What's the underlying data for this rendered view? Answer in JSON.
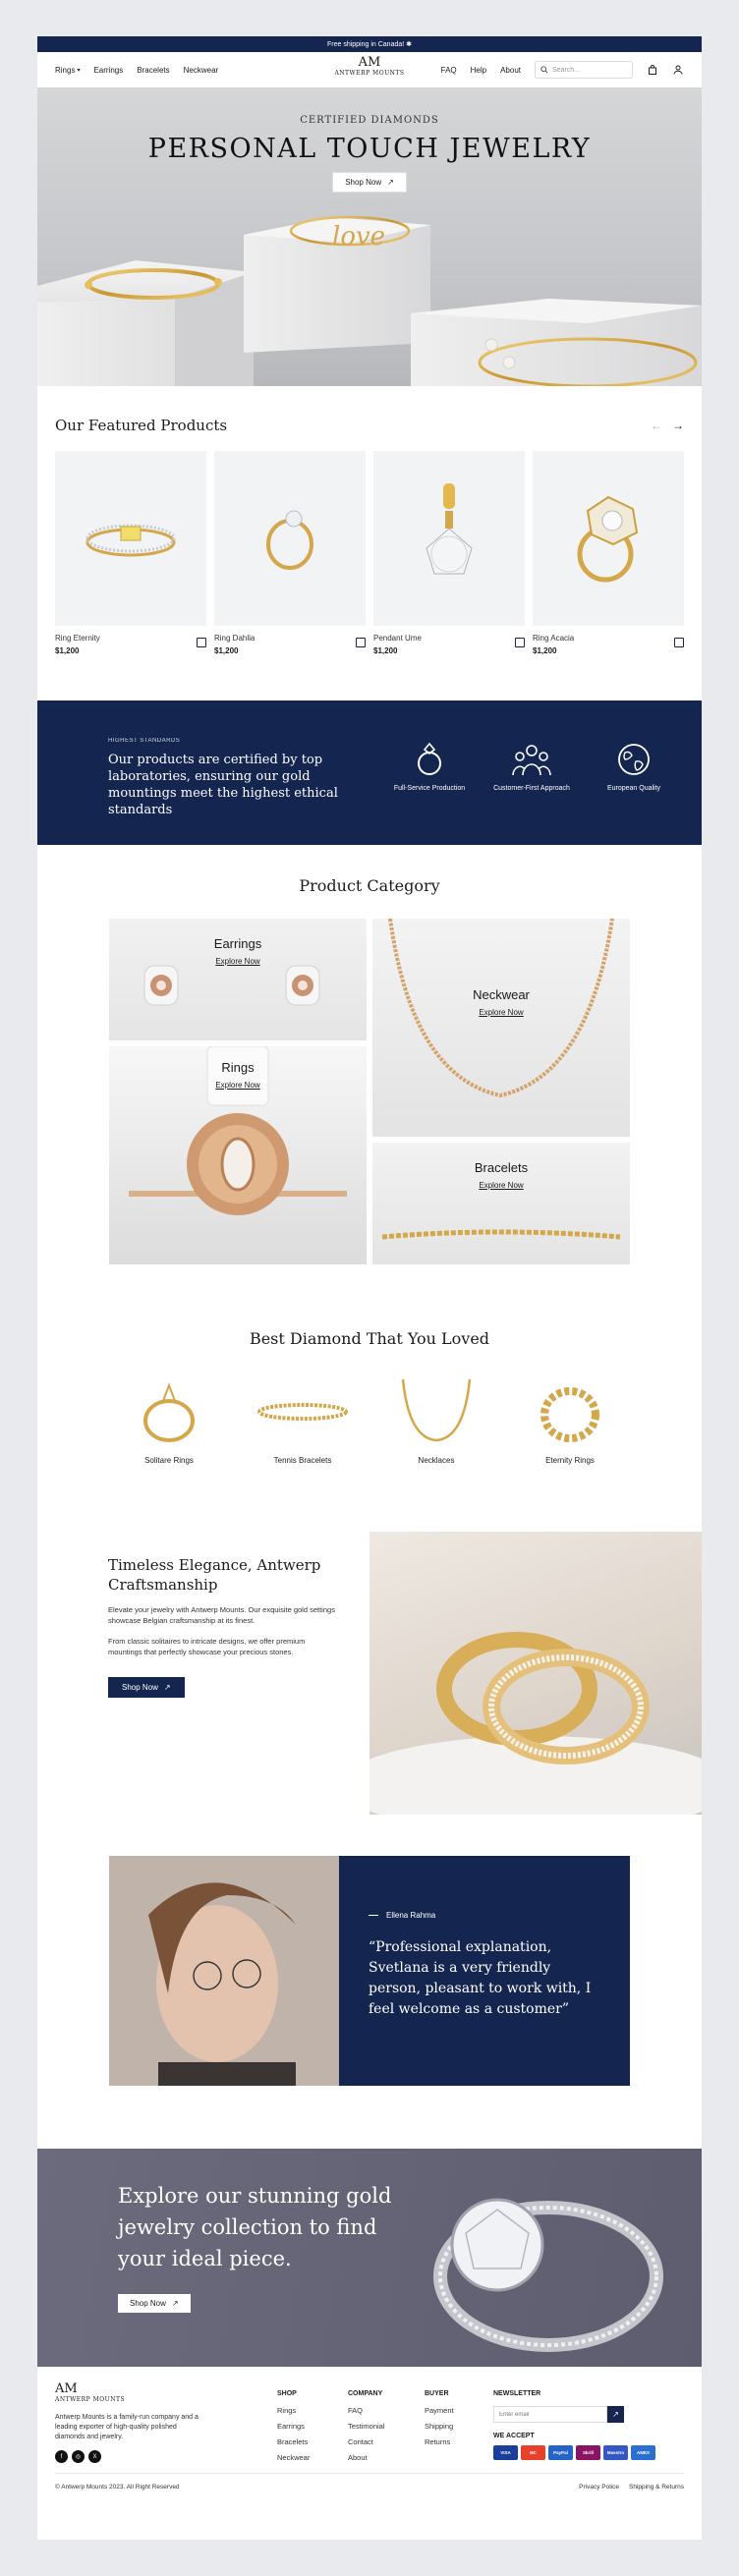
{
  "announcement": "Free shipping in Canada! ✱",
  "nav": {
    "left": [
      "Rings",
      "Earrings",
      "Bracelets",
      "Neckwear"
    ],
    "logo_mark": "AM",
    "logo_text": "ANTWERP MOUNTS",
    "right": [
      "FAQ",
      "Help",
      "About"
    ],
    "search_placeholder": "Search..."
  },
  "hero": {
    "eyebrow": "CERTIFIED DIAMONDS",
    "title": "PERSONAL TOUCH JEWELRY",
    "button": "Shop Now",
    "bracelet_script": "love"
  },
  "featured": {
    "title": "Our Featured Products",
    "products": [
      {
        "name": "Ring Eternity",
        "price": "$1,200"
      },
      {
        "name": "Ring Dahlia",
        "price": "$1,200"
      },
      {
        "name": "Pendant Ume",
        "price": "$1,200"
      },
      {
        "name": "Ring Acacia",
        "price": "$1,200"
      }
    ]
  },
  "standards": {
    "eyebrow": "HIGHEST STANDARDS",
    "text": "Our products are certified by top laboratories, ensuring our gold mountings meet the highest ethical standards",
    "items": [
      {
        "icon": "ring-icon",
        "label": "Full-Service Production"
      },
      {
        "icon": "people-icon",
        "label": "Customer-First Approach"
      },
      {
        "icon": "globe-icon",
        "label": "European Quality"
      }
    ]
  },
  "category": {
    "title": "Product Category",
    "tiles": [
      {
        "name": "Earrings",
        "link": "Explore Now"
      },
      {
        "name": "Neckwear",
        "link": "Explore Now"
      },
      {
        "name": "Rings",
        "link": "Explore Now"
      },
      {
        "name": "Bracelets",
        "link": "Explore Now"
      }
    ]
  },
  "loved": {
    "title": "Best Diamond That You Loved",
    "items": [
      "Solitare Rings",
      "Tennis Bracelets",
      "Necklaces",
      "Eternity Rings"
    ]
  },
  "timeless": {
    "title": "Timeless Elegance, Antwerp Craftsmanship",
    "p1": "Elevate your jewelry with Antwerp Mounts. Our exquisite gold settings showcase Belgian craftsmanship at its finest.",
    "p2": "From classic solitaires to intricate designs, we offer premium mountings that perfectly showcase your precious stones.",
    "button": "Shop Now"
  },
  "testimonial": {
    "name": "Ellena Rahma",
    "quote": "“Professional explanation, Svetlana is a very friendly person, pleasant to work with, I feel welcome as a customer”"
  },
  "explore": {
    "title": "Explore our stunning gold jewelry collection to find your ideal piece.",
    "button": "Shop Now"
  },
  "footer": {
    "description": "Antwerp Mounts is a family-run company and a leading exporter of high-quality polished diamonds and jewelry.",
    "socials": [
      "f",
      "◎",
      "X"
    ],
    "shop": {
      "title": "SHOP",
      "links": [
        "Rings",
        "Earrings",
        "Bracelets",
        "Neckwear"
      ]
    },
    "company": {
      "title": "COMPANY",
      "links": [
        "FAQ",
        "Testimonial",
        "Contact",
        "About"
      ]
    },
    "buyer": {
      "title": "BUYER",
      "links": [
        "Payment",
        "Shipping",
        "Returns"
      ]
    },
    "newsletter": {
      "title": "NEWSLETTER",
      "placeholder": "Enter email",
      "accept": "WE ACCEPT"
    },
    "payments": [
      {
        "label": "VISA",
        "color": "#1a3e9c"
      },
      {
        "label": "MC",
        "color": "#e8402a"
      },
      {
        "label": "PayPal",
        "color": "#2563c9"
      },
      {
        "label": "Skrill",
        "color": "#8a1464"
      },
      {
        "label": "Maestro",
        "color": "#3557c6"
      },
      {
        "label": "AMEX",
        "color": "#2b6fd0"
      }
    ],
    "copyright": "© Antwerp Mounts 2023. All Right Reserved",
    "bottom_links": [
      "Privacy Police",
      "Shipping & Returns"
    ]
  },
  "colors": {
    "navy": "#142650",
    "gold": "#d4a74a"
  }
}
